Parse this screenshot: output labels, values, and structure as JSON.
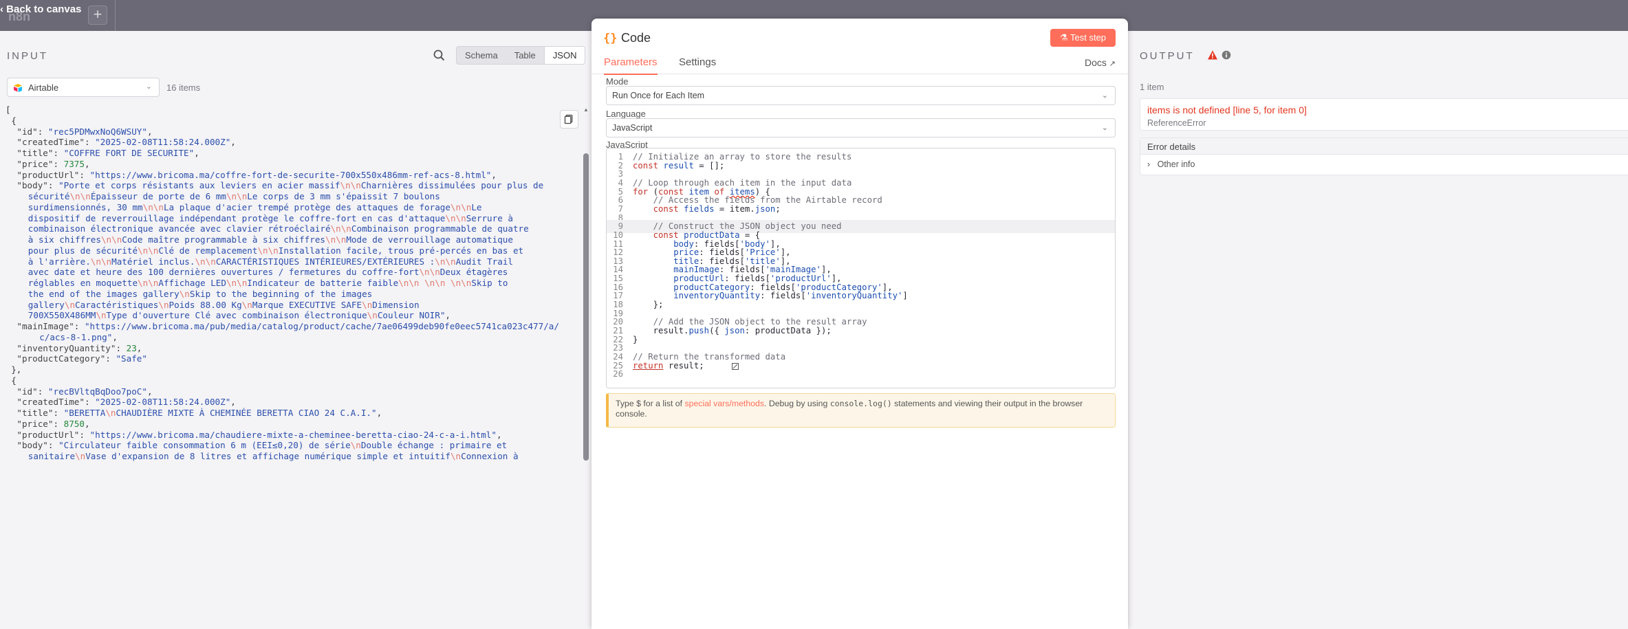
{
  "topbar": {
    "workflow_tab": "n8n",
    "back_label": "Back to canvas",
    "add_label": "+"
  },
  "input": {
    "title": "INPUT",
    "views": [
      "Schema",
      "Table",
      "JSON"
    ],
    "active_view": "JSON",
    "node_select": "Airtable",
    "items_count": "16 items",
    "json_lines": [
      {
        "indent": 0,
        "html": "["
      },
      {
        "indent": 1,
        "html": "{"
      },
      {
        "indent": 2,
        "html": "<span class='jk'>\"id\"</span>: <span class='js'>\"rec5PDMwxNoQ6WSUY\"</span>,"
      },
      {
        "indent": 2,
        "html": "<span class='jk'>\"createdTime\"</span>: <span class='js'>\"2025-02-08T11:58:24.000Z\"</span>,"
      },
      {
        "indent": 2,
        "html": "<span class='jk'>\"title\"</span>: <span class='js'>\"COFFRE FORT DE SECURITE\"</span>,"
      },
      {
        "indent": 2,
        "html": "<span class='jk'>\"price\"</span>: <span class='jn'>7375</span>,"
      },
      {
        "indent": 2,
        "html": "<span class='jk'>\"productUrl\"</span>: <span class='js'>\"https://www.bricoma.ma/coffre-fort-de-securite-700x550x486mm-ref-acs-8.html\"</span>,"
      },
      {
        "indent": 2,
        "html": "<span class='jk'>\"body\"</span>: <span class='js'>\"Porte et corps résistants aux leviers en acier massif<span class='esc'>\\n\\n</span>Charnières dissimulées pour plus de</span>"
      },
      {
        "indent": 4,
        "html": "<span class='js'>sécurité<span class='esc'>\\n\\n</span>Épaisseur de porte de 6 mm<span class='esc'>\\n\\n</span>Le corps de 3 mm s'épaissit 7 boulons</span>"
      },
      {
        "indent": 4,
        "html": "<span class='js'>surdimensionnés, 30 mm<span class='esc'>\\n\\n</span>La plaque d'acier trempé protège des attaques de forage<span class='esc'>\\n\\n</span>Le</span>"
      },
      {
        "indent": 4,
        "html": "<span class='js'>dispositif de reverrouillage indépendant protège le coffre-fort en cas d'attaque<span class='esc'>\\n\\n</span>Serrure à</span>"
      },
      {
        "indent": 4,
        "html": "<span class='js'>combinaison électronique avancée avec clavier rétroéclairé<span class='esc'>\\n\\n</span>Combinaison programmable de quatre</span>"
      },
      {
        "indent": 4,
        "html": "<span class='js'>à six chiffres<span class='esc'>\\n\\n</span>Code maître programmable à six chiffres<span class='esc'>\\n\\n</span>Mode de verrouillage automatique</span>"
      },
      {
        "indent": 4,
        "html": "<span class='js'>pour plus de sécurité<span class='esc'>\\n\\n</span>Clé de remplacement<span class='esc'>\\n\\n</span>Installation facile, trous pré-percés en bas et</span>"
      },
      {
        "indent": 4,
        "html": "<span class='js'>à l'arrière.<span class='esc'>\\n\\n</span>Matériel inclus.<span class='esc'>\\n\\n</span>CARACTÉRISTIQUES INTÉRIEURES/EXTÉRIEURES :<span class='esc'>\\n\\n</span>Audit Trail</span>"
      },
      {
        "indent": 4,
        "html": "<span class='js'>avec date et heure des 100 dernières ouvertures / fermetures du coffre-fort<span class='esc'>\\n\\n</span>Deux étagères</span>"
      },
      {
        "indent": 4,
        "html": "<span class='js'>réglables en moquette<span class='esc'>\\n\\n</span>Affichage LED<span class='esc'>\\n\\n</span>Indicateur de batterie faible<span class='esc'>\\n\\n \\n\\n \\n\\n</span>Skip to</span>"
      },
      {
        "indent": 4,
        "html": "<span class='js'>the end of the images gallery<span class='esc'>\\n</span>Skip to the beginning of the images</span>"
      },
      {
        "indent": 4,
        "html": "<span class='js'>gallery<span class='esc'>\\n</span>Caractéristiques<span class='esc'>\\n</span>Poids       88.00 Kg<span class='esc'>\\n</span>Marque        EXECUTIVE SAFE<span class='esc'>\\n</span>Dimension</span>"
      },
      {
        "indent": 4,
        "html": "<span class='js'>700X550X486MM<span class='esc'>\\n</span>Type d'ouverture Clé avec combinaison électronique<span class='esc'>\\n</span>Couleur      NOIR\"</span>,"
      },
      {
        "indent": 2,
        "html": "<span class='jk'>\"mainImage\"</span>: <span class='js'>\"https://www.bricoma.ma/pub/media/catalog/product/cache/7ae06499deb90fe0eec5741ca023c477/a/</span>"
      },
      {
        "indent": 6,
        "html": "<span class='js'>c/acs-8-1.png\"</span>,"
      },
      {
        "indent": 2,
        "html": "<span class='jk'>\"inventoryQuantity\"</span>: <span class='jn'>23</span>,"
      },
      {
        "indent": 2,
        "html": "<span class='jk'>\"productCategory\"</span>: <span class='js'>\"Safe\"</span>"
      },
      {
        "indent": 1,
        "html": "},"
      },
      {
        "indent": 1,
        "html": "{"
      },
      {
        "indent": 2,
        "html": "<span class='jk'>\"id\"</span>: <span class='js'>\"recBVltqBqDoo7poC\"</span>,"
      },
      {
        "indent": 2,
        "html": "<span class='jk'>\"createdTime\"</span>: <span class='js'>\"2025-02-08T11:58:24.000Z\"</span>,"
      },
      {
        "indent": 2,
        "html": "<span class='jk'>\"title\"</span>: <span class='js'>\"BERETTA<span class='esc'>\\n</span>CHAUDIÈRE MIXTE À CHEMINÉE BERETTA CIAO 24 C.A.I.\"</span>,"
      },
      {
        "indent": 2,
        "html": "<span class='jk'>\"price\"</span>: <span class='jn'>8750</span>,"
      },
      {
        "indent": 2,
        "html": "<span class='jk'>\"productUrl\"</span>: <span class='js'>\"https://www.bricoma.ma/chaudiere-mixte-a-cheminee-beretta-ciao-24-c-a-i.html\"</span>,"
      },
      {
        "indent": 2,
        "html": "<span class='jk'>\"body\"</span>: <span class='js'>\"Circulateur faible consommation 6 m (EEI≤0,20) de série<span class='esc'>\\n</span>Double échange : primaire et</span>"
      },
      {
        "indent": 4,
        "html": "<span class='js'>sanitaire<span class='esc'>\\n</span>Vase d'expansion de 8 litres et affichage numérique simple et intuitif<span class='esc'>\\n</span>Connexion à</span>"
      }
    ]
  },
  "code": {
    "title": "Code",
    "test_label": "Test step",
    "tabs": [
      "Parameters",
      "Settings"
    ],
    "active_tab": "Parameters",
    "docs_label": "Docs",
    "mode_label": "Mode",
    "mode_value": "Run Once for Each Item",
    "language_label": "Language",
    "language_value": "JavaScript",
    "editor_label": "JavaScript",
    "highlight_line": 9,
    "lines": [
      "<span class='cm'>// Initialize an array to store the results</span>",
      "<span class='kw'>const</span> <span class='pr'>result</span> = [];",
      "",
      "<span class='cm'>// Loop through each item in the input data</span>",
      "<span class='kw'>for</span> (<span class='kw'>const</span> <span class='pr'>item</span> <span class='kw'>of</span> <span class='pr' style='text-decoration: underline wavy #e3361f;'>items</span>) {",
      "    <span class='cm'>// Access the fields from the Airtable record</span>",
      "    <span class='kw'>const</span> <span class='pr'>fields</span> = item.<span class='pr'>json</span>;",
      "",
      "    <span class='cm'>// Construct the JSON object you need</span>",
      "    <span class='kw'>const</span> <span class='pr'>productData</span> = {",
      "        <span class='pr'>body</span>: fields[<span class='st'>'body'</span>],",
      "        <span class='pr'>price</span>: fields[<span class='st'>'Price'</span>],",
      "        <span class='pr'>title</span>: fields[<span class='st'>'title'</span>],",
      "        <span class='pr'>mainImage</span>: fields[<span class='st'>'mainImage'</span>],",
      "        <span class='pr'>productUrl</span>: fields[<span class='st'>'productUrl'</span>],",
      "        <span class='pr'>productCategory</span>: fields[<span class='st'>'productCategory'</span>],",
      "        <span class='pr'>inventoryQuantity</span>: fields[<span class='st'>'inventoryQuantity'</span>]",
      "    };",
      "",
      "    <span class='cm'>// Add the JSON object to the result array</span>",
      "    result.<span class='fn'>push</span>({ <span class='pr'>json</span>: productData });",
      "}",
      "",
      "<span class='cm'>// Return the transformed data</span>",
      "<span class='kw' style='text-decoration: underline;'>return</span> result;",
      ""
    ],
    "hint_prefix": "Type $ for a list of ",
    "hint_link": "special vars/methods",
    "hint_mid": ". Debug by using ",
    "hint_code": "console.log()",
    "hint_suffix": " statements and viewing their output in the browser console."
  },
  "output": {
    "title": "OUTPUT",
    "count": "1 item",
    "error_title": "items is not defined [line 5, for item 0]",
    "error_type": "ReferenceError",
    "details_title": "Error details",
    "other_info": "Other info"
  },
  "colors": {
    "accent": "#ff6e5a",
    "error": "#e3361f",
    "warning": "#f5b947"
  }
}
